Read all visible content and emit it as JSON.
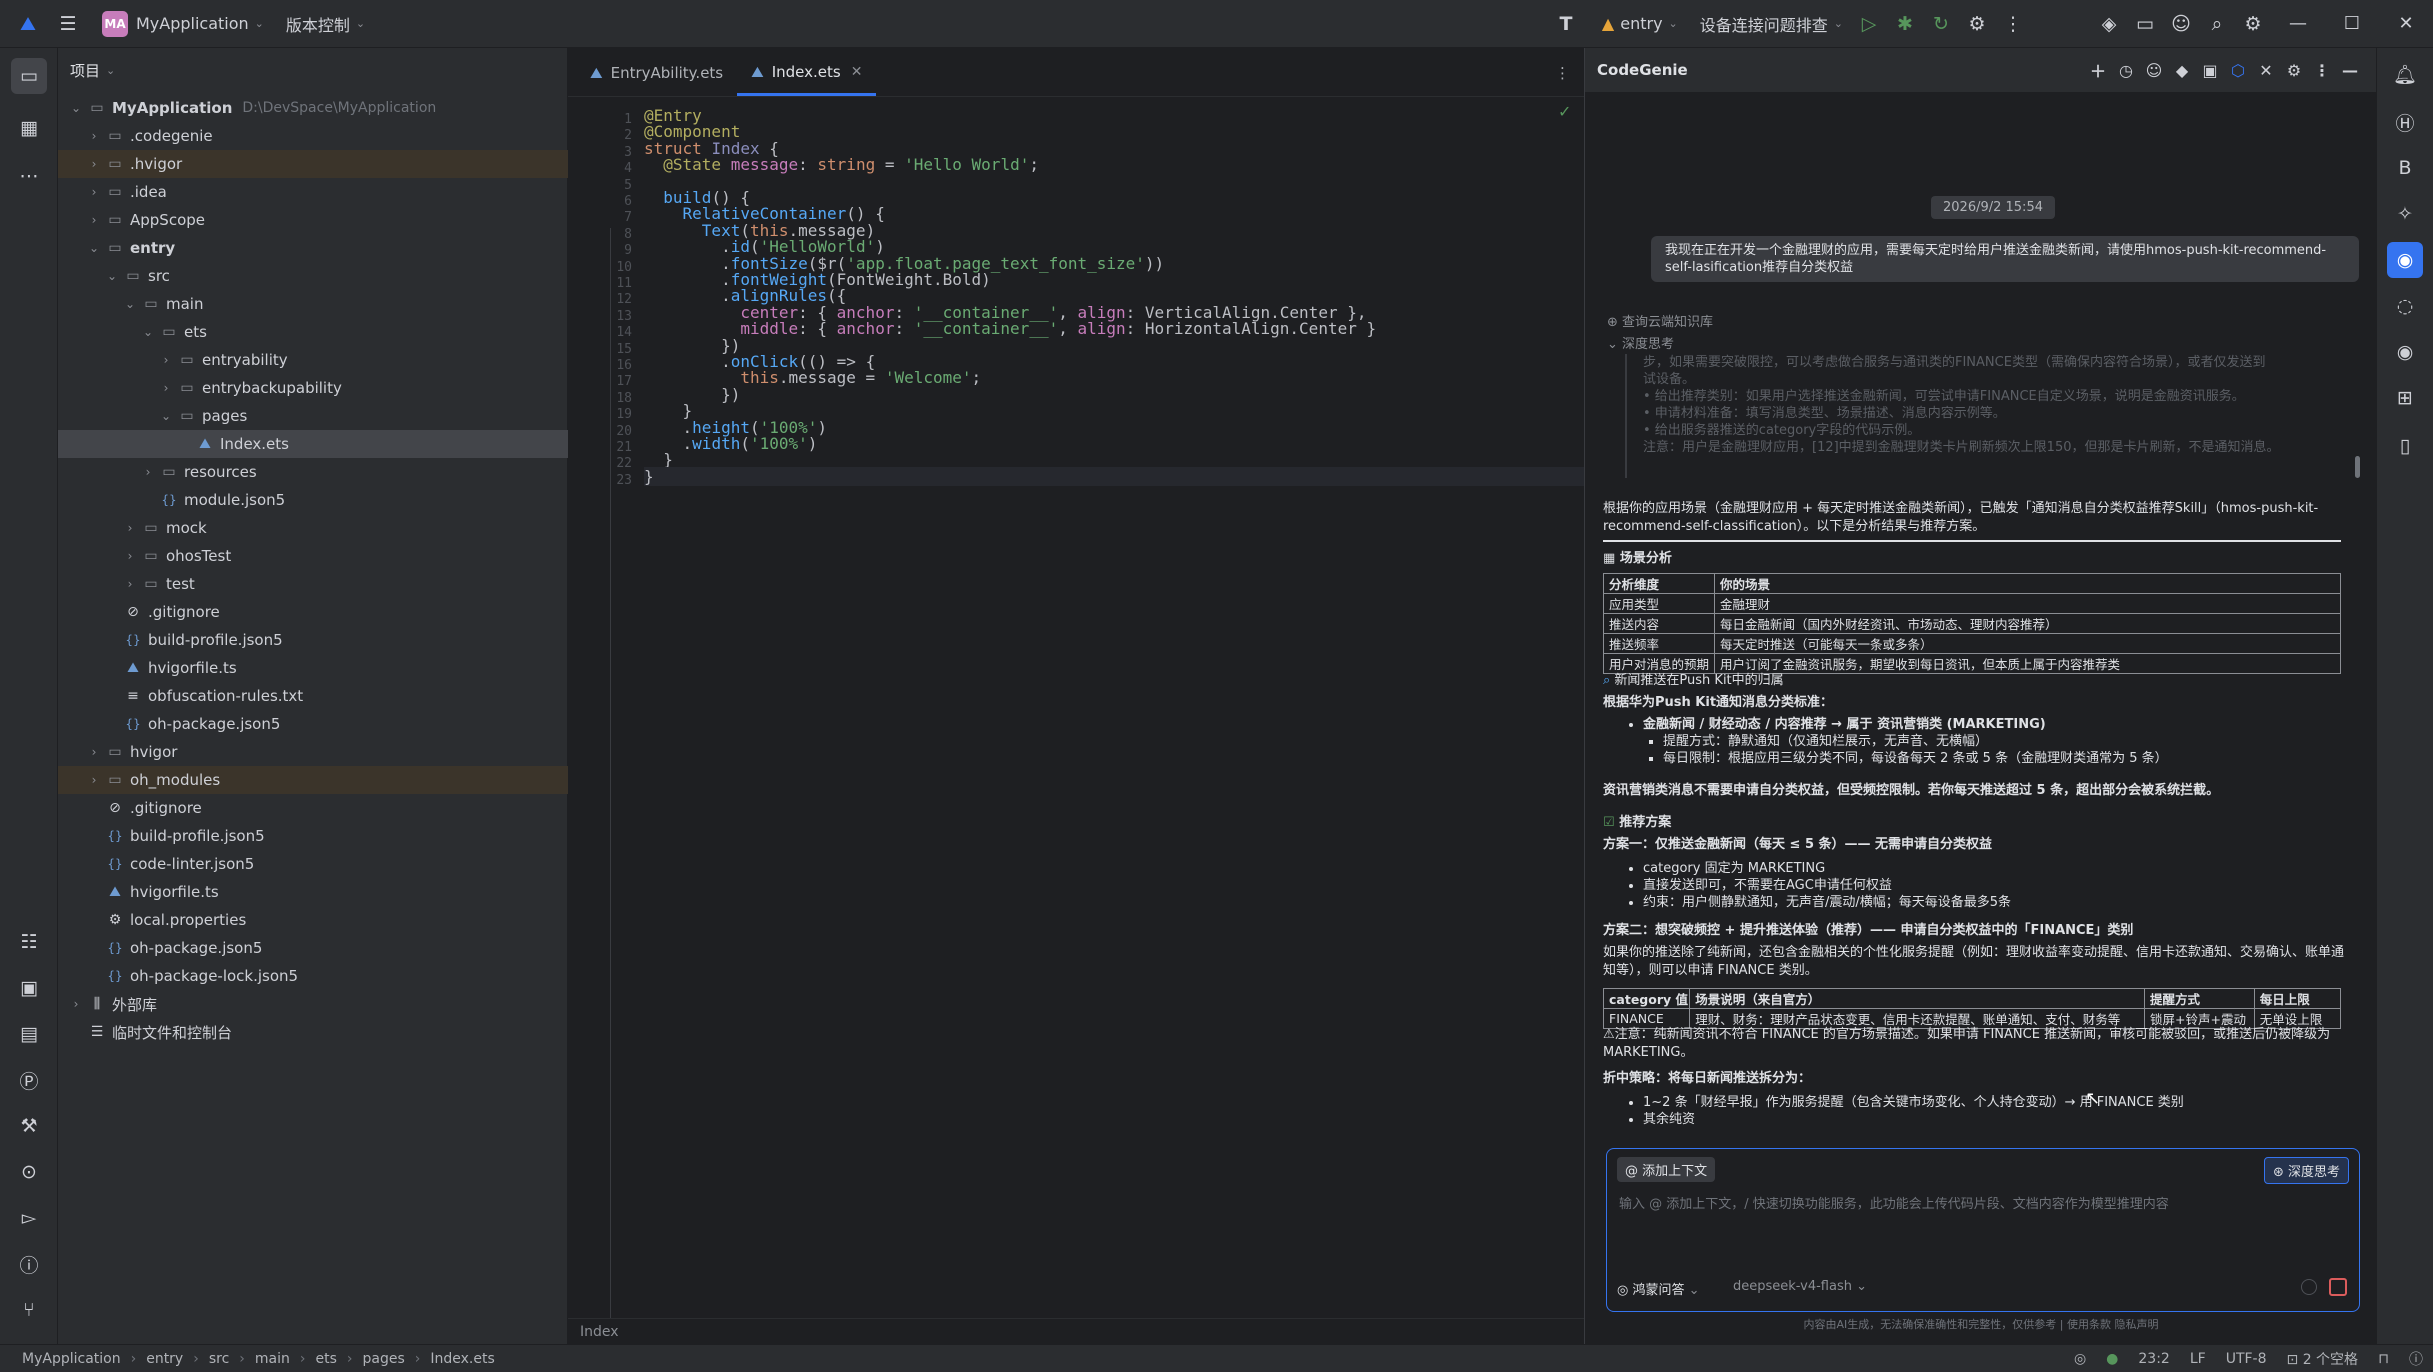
{
  "titlebar": {
    "project_badge": "MA",
    "project_name": "MyApplication",
    "vcs": "版本控制",
    "run_config": "entry",
    "device": "设备连接问题排查"
  },
  "project_panel": {
    "title": "项目",
    "tree": [
      {
        "label": "MyApplication",
        "path": "D:\\DevSpace\\MyApplication",
        "depth": 0,
        "type": "folder",
        "open": true,
        "bold": true
      },
      {
        "label": ".codegenie",
        "depth": 1,
        "type": "folder"
      },
      {
        "label": ".hvigor",
        "depth": 1,
        "type": "folder",
        "hl": true
      },
      {
        "label": ".idea",
        "depth": 1,
        "type": "folder"
      },
      {
        "label": "AppScope",
        "depth": 1,
        "type": "folder"
      },
      {
        "label": "entry",
        "depth": 1,
        "type": "folder",
        "open": true,
        "bold": true
      },
      {
        "label": "src",
        "depth": 2,
        "type": "folder",
        "open": true
      },
      {
        "label": "main",
        "depth": 3,
        "type": "folder",
        "open": true
      },
      {
        "label": "ets",
        "depth": 4,
        "type": "folder",
        "open": true
      },
      {
        "label": "entryability",
        "depth": 5,
        "type": "folder"
      },
      {
        "label": "entrybackupability",
        "depth": 5,
        "type": "folder"
      },
      {
        "label": "pages",
        "depth": 5,
        "type": "folder",
        "open": true
      },
      {
        "label": "Index.ets",
        "depth": 6,
        "type": "ets",
        "sel": true
      },
      {
        "label": "resources",
        "depth": 4,
        "type": "folder"
      },
      {
        "label": "module.json5",
        "depth": 4,
        "type": "json"
      },
      {
        "label": "mock",
        "depth": 3,
        "type": "folder"
      },
      {
        "label": "ohosTest",
        "depth": 3,
        "type": "folder"
      },
      {
        "label": "test",
        "depth": 3,
        "type": "folder"
      },
      {
        "label": ".gitignore",
        "depth": 2,
        "type": "ignore"
      },
      {
        "label": "build-profile.json5",
        "depth": 2,
        "type": "json"
      },
      {
        "label": "hvigorfile.ts",
        "depth": 2,
        "type": "ets"
      },
      {
        "label": "obfuscation-rules.txt",
        "depth": 2,
        "type": "txt"
      },
      {
        "label": "oh-package.json5",
        "depth": 2,
        "type": "json"
      },
      {
        "label": "hvigor",
        "depth": 1,
        "type": "folder"
      },
      {
        "label": "oh_modules",
        "depth": 1,
        "type": "folder",
        "hl": true
      },
      {
        "label": ".gitignore",
        "depth": 1,
        "type": "ignore"
      },
      {
        "label": "build-profile.json5",
        "depth": 1,
        "type": "json"
      },
      {
        "label": "code-linter.json5",
        "depth": 1,
        "type": "json"
      },
      {
        "label": "hvigorfile.ts",
        "depth": 1,
        "type": "ets"
      },
      {
        "label": "local.properties",
        "depth": 1,
        "type": "gear"
      },
      {
        "label": "oh-package.json5",
        "depth": 1,
        "type": "json"
      },
      {
        "label": "oh-package-lock.json5",
        "depth": 1,
        "type": "json"
      },
      {
        "label": "外部库",
        "depth": 0,
        "type": "lib"
      },
      {
        "label": "临时文件和控制台",
        "depth": 0,
        "type": "scratch",
        "nochev": true
      }
    ]
  },
  "editor": {
    "tabs": [
      {
        "label": "EntryAbility.ets",
        "active": false
      },
      {
        "label": "Index.ets",
        "active": true
      }
    ],
    "footer": "Index",
    "lines": [
      "@Entry",
      "@Component",
      "struct Index {",
      "  @State message: string = 'Hello World';",
      "",
      "  build() {",
      "    RelativeContainer() {",
      "      Text(this.message)",
      "        .id('HelloWorld')",
      "        .fontSize($r('app.float.page_text_font_size'))",
      "        .fontWeight(FontWeight.Bold)",
      "        .alignRules({",
      "          center: { anchor: '__container__', align: VerticalAlign.Center },",
      "          middle: { anchor: '__container__', align: HorizontalAlign.Center }",
      "        })",
      "        .onClick(() => {",
      "          this.message = 'Welcome';",
      "        })",
      "    }",
      "    .height('100%')",
      "    .width('100%')",
      "  }",
      "}"
    ]
  },
  "genie": {
    "title": "CodeGenie",
    "date": "2026/9/2 15:54",
    "user_msg": "我现在正在开发一个金融理财的应用，需要每天定时给用户推送金融类新闻，请使用hmos-push-kit-recommend-self-lasification推荐自分类权益",
    "search_kb": "查询云端知识库",
    "deep_think": "深度思考",
    "think_lines": [
      "步，如果需要突破限控，可以考虑做合服务与通讯类的FINANCE类型（需确保内容符合场景），或者仅发送到",
      "试设备。",
      "• 给出推荐类别：如果用户选择推送金融新闻，可尝试申请FINANCE自定义场景，说明是金融资讯服务。",
      "• 申请材料准备：填写消息类型、场景描述、消息内容示例等。",
      "• 给出服务器推送的category字段的代码示例。",
      "",
      "注意：用户是金融理财应用，[12]中提到金融理财类卡片刷新频次上限150，但那是卡片刷新，不是通知消息。"
    ],
    "intro": "根据你的应用场景（金融理财应用 + 每天定时推送金融类新闻），已触发「通知消息自分类权益推荐Skill」（hmos-push-kit-recommend-self-classification）。以下是分析结果与推荐方案。",
    "scene_title": "场景分析",
    "scene_table": {
      "headers": [
        "分析维度",
        "你的场景"
      ],
      "rows": [
        [
          "应用类型",
          "金融理财"
        ],
        [
          "推送内容",
          "每日金融新闻（国内外财经资讯、市场动态、理财内容推荐）"
        ],
        [
          "推送频率",
          "每天定时推送（可能每天一条或多条）"
        ],
        [
          "用户对消息的预期",
          "用户订阅了金融资讯服务，期望收到每日资讯，但本质上属于内容推荐类"
        ]
      ]
    },
    "push_title": "新闻推送在Push Kit中的归属",
    "push_std": "根据华为Push Kit通知消息分类标准：",
    "push_items": [
      "金融新闻 / 财经动态 / 内容推荐 → 属于 资讯营销类 (MARKETING)",
      "提醒方式：静默通知（仅通知栏展示，无声音、无横幅）",
      "每日限制：根据应用三级分类不同，每设备每天 2 条或 5 条（金融理财类通常为 5 条）"
    ],
    "push_note": "资讯营销类消息不需要申请自分类权益，但受频控限制。若你每天推送超过 5 条，超出部分会被系统拦截。",
    "plan_title": "推荐方案",
    "plan1_title": "方案一：仅推送金融新闻（每天 ≤ 5 条）—— 无需申请自分类权益",
    "plan1_items": [
      "category 固定为 MARKETING",
      "直接发送即可，不需要在AGC申请任何权益",
      "约束：用户侧静默通知，无声音/震动/横幅；每天每设备最多5条"
    ],
    "plan2_title": "方案二：想突破频控 + 提升推送体验（推荐）—— 申请自分类权益中的「FINANCE」类别",
    "plan2_desc": "如果你的推送除了纯新闻，还包含金融相关的个性化服务提醒（例如：理财收益率变动提醒、信用卡还款通知、交易确认、账单通知等），则可以申请 FINANCE 类别。",
    "cat_table": {
      "headers": [
        "category 值",
        "场景说明（来自官方）",
        "提醒方式",
        "每日上限"
      ],
      "rows": [
        [
          "FINANCE",
          "理财、财务：理财产品状态变更、信用卡还款提醒、账单通知、支付、财务等",
          "锁屏+铃声+震动",
          "无单设上限"
        ]
      ]
    },
    "notice": "⚠注意：纯新闻资讯不符合 FINANCE 的官方场景描述。如果申请 FINANCE 推送新闻，审核可能被驳回，或推送后仍被降级为 MARKETING。",
    "compromise_title": "折中策略：将每日新闻推送拆分为：",
    "compromise_items": [
      "1~2 条「财经早报」作为服务提醒（包含关键市场变化、个人持仓变动）→ 用 FINANCE 类别",
      "其余纯资"
    ],
    "input": {
      "add_context": "添加上下文",
      "deep_btn": "深度思考",
      "placeholder": "输入 @ 添加上下文，/ 快速切换功能服务，此功能会上传代码片段、文档内容作为模型推理内容",
      "mode": "鸿蒙问答",
      "model": "deepseek-v4-flash"
    },
    "disclaimer": "内容由AI生成，无法确保准确性和完整性，仅供参考 | 使用条款  隐私声明"
  },
  "statusbar": {
    "crumbs": [
      "MyApplication",
      "entry",
      "src",
      "main",
      "ets",
      "pages",
      "Index.ets"
    ],
    "position": "23:2",
    "line_sep": "LF",
    "encoding": "UTF-8",
    "indent": "2 个空格"
  }
}
